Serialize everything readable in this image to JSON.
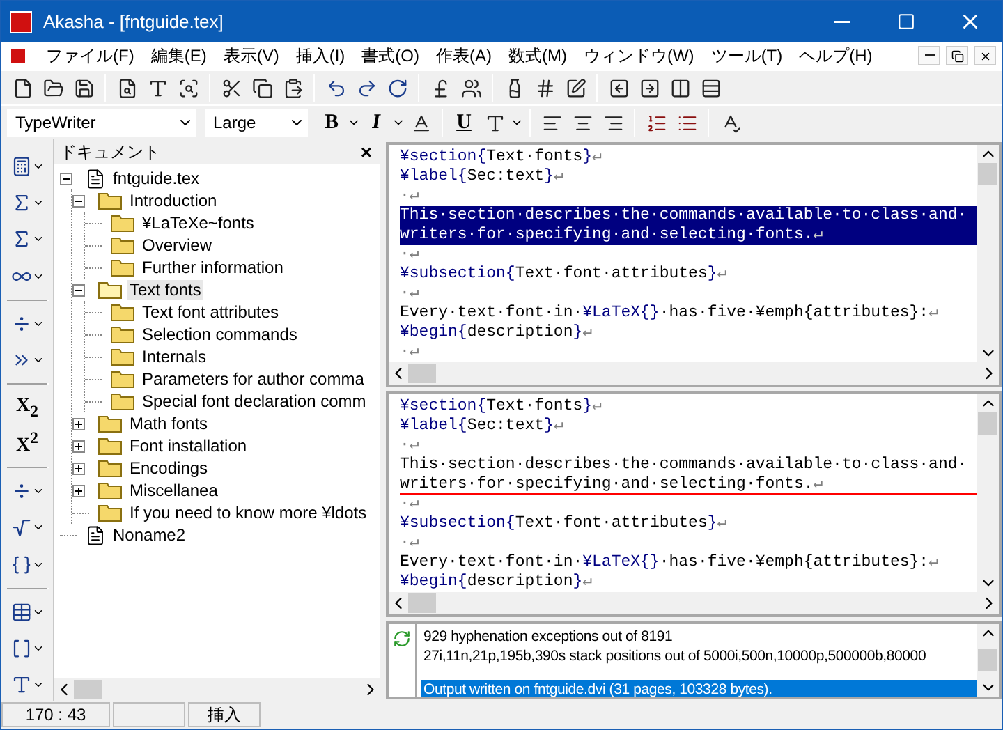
{
  "window": {
    "title": "Akasha - [fntguide.tex]"
  },
  "menu": [
    "ファイル(F)",
    "編集(E)",
    "表示(V)",
    "挿入(I)",
    "書式(O)",
    "作表(A)",
    "数式(M)",
    "ウィンドウ(W)",
    "ツール(T)",
    "ヘルプ(H)"
  ],
  "format_bar": {
    "font": "TypeWriter",
    "size": "Large",
    "bold": "B",
    "italic": "I",
    "underline": "U"
  },
  "side_toolbar": {
    "subscript": "X$_{2}$",
    "superscript": "X$^{2}$"
  },
  "document_panel": {
    "title": "ドキュメント",
    "close": "×",
    "tree": [
      {
        "label": "fntguide.tex",
        "kind": "file",
        "expanded": true,
        "selected": false,
        "children": [
          {
            "label": "Introduction",
            "kind": "folder",
            "expanded": true,
            "selected": false,
            "children": [
              {
                "label": "¥LaTeXe~fonts",
                "kind": "folder",
                "selected": false
              },
              {
                "label": "Overview",
                "kind": "folder",
                "selected": false
              },
              {
                "label": "Further information",
                "kind": "folder",
                "selected": false
              }
            ]
          },
          {
            "label": "Text fonts",
            "kind": "folder",
            "expanded": true,
            "selected": true,
            "children": [
              {
                "label": "Text font attributes",
                "kind": "folder",
                "selected": false
              },
              {
                "label": "Selection commands",
                "kind": "folder",
                "selected": false
              },
              {
                "label": "Internals",
                "kind": "folder",
                "selected": false
              },
              {
                "label": "Parameters for author comma",
                "kind": "folder",
                "selected": false
              },
              {
                "label": "Special font declaration comm",
                "kind": "folder",
                "selected": false
              }
            ]
          },
          {
            "label": "Math fonts",
            "kind": "folder",
            "expanded": false,
            "selected": false
          },
          {
            "label": "Font installation",
            "kind": "folder",
            "expanded": false,
            "selected": false
          },
          {
            "label": "Encodings",
            "kind": "folder",
            "expanded": false,
            "selected": false
          },
          {
            "label": "Miscellanea",
            "kind": "folder",
            "expanded": false,
            "selected": false
          },
          {
            "label": "If you need to know more ¥ldots",
            "kind": "folder",
            "selected": false
          }
        ]
      },
      {
        "label": "Noname2",
        "kind": "file",
        "selected": false
      }
    ]
  },
  "editor_panes": [
    {
      "lines": [
        {
          "selected": false,
          "current": false,
          "segments": [
            {
              "kind": "command",
              "text": "¥section{"
            },
            {
              "kind": "plain",
              "text": "Text·fonts"
            },
            {
              "kind": "command",
              "text": "}"
            },
            {
              "kind": "mark",
              "text": "↵"
            }
          ]
        },
        {
          "selected": false,
          "current": false,
          "segments": [
            {
              "kind": "command",
              "text": "¥label{"
            },
            {
              "kind": "plain",
              "text": "Sec:text"
            },
            {
              "kind": "command",
              "text": "}"
            },
            {
              "kind": "mark",
              "text": "↵"
            }
          ]
        },
        {
          "selected": false,
          "current": false,
          "segments": [
            {
              "kind": "mark",
              "text": "·↵"
            }
          ]
        },
        {
          "selected": true,
          "current": false,
          "segments": [
            {
              "kind": "plain",
              "text": "This·section·describes·the·commands·available·to·class·and·"
            }
          ]
        },
        {
          "selected": true,
          "current": false,
          "segments": [
            {
              "kind": "plain",
              "text": "writers·for·specifying·and·selecting·fonts."
            },
            {
              "kind": "mark",
              "text": "↵"
            }
          ]
        },
        {
          "selected": false,
          "current": false,
          "segments": [
            {
              "kind": "mark",
              "text": "·↵"
            }
          ]
        },
        {
          "selected": false,
          "current": false,
          "segments": [
            {
              "kind": "command",
              "text": "¥subsection{"
            },
            {
              "kind": "plain",
              "text": "Text·font·attributes"
            },
            {
              "kind": "command",
              "text": "}"
            },
            {
              "kind": "mark",
              "text": "↵"
            }
          ]
        },
        {
          "selected": false,
          "current": false,
          "segments": [
            {
              "kind": "mark",
              "text": "·↵"
            }
          ]
        },
        {
          "selected": false,
          "current": false,
          "segments": [
            {
              "kind": "plain",
              "text": "Every·text·font·in·"
            },
            {
              "kind": "command",
              "text": "¥LaTeX{}"
            },
            {
              "kind": "plain",
              "text": "·has·five·¥emph{attributes}:"
            },
            {
              "kind": "mark",
              "text": "↵"
            }
          ]
        },
        {
          "selected": false,
          "current": false,
          "segments": [
            {
              "kind": "command",
              "text": "¥begin{"
            },
            {
              "kind": "plain",
              "text": "description"
            },
            {
              "kind": "command",
              "text": "}"
            },
            {
              "kind": "mark",
              "text": "↵"
            }
          ]
        },
        {
          "selected": false,
          "current": false,
          "segments": [
            {
              "kind": "mark",
              "text": "·↵"
            }
          ]
        }
      ]
    },
    {
      "lines": [
        {
          "selected": false,
          "current": false,
          "segments": [
            {
              "kind": "command",
              "text": "¥section{"
            },
            {
              "kind": "plain",
              "text": "Text·fonts"
            },
            {
              "kind": "command",
              "text": "}"
            },
            {
              "kind": "mark",
              "text": "↵"
            }
          ]
        },
        {
          "selected": false,
          "current": false,
          "segments": [
            {
              "kind": "command",
              "text": "¥label{"
            },
            {
              "kind": "plain",
              "text": "Sec:text"
            },
            {
              "kind": "command",
              "text": "}"
            },
            {
              "kind": "mark",
              "text": "↵"
            }
          ]
        },
        {
          "selected": false,
          "current": false,
          "segments": [
            {
              "kind": "mark",
              "text": "·↵"
            }
          ]
        },
        {
          "selected": false,
          "current": false,
          "segments": [
            {
              "kind": "plain",
              "text": "This·section·describes·the·commands·available·to·class·and·"
            }
          ]
        },
        {
          "selected": false,
          "current": true,
          "segments": [
            {
              "kind": "plain",
              "text": "writers·for·specifying·and·selecting·fonts."
            },
            {
              "kind": "mark",
              "text": "↵"
            }
          ]
        },
        {
          "selected": false,
          "current": false,
          "segments": [
            {
              "kind": "mark",
              "text": "·↵"
            }
          ]
        },
        {
          "selected": false,
          "current": false,
          "segments": [
            {
              "kind": "command",
              "text": "¥subsection{"
            },
            {
              "kind": "plain",
              "text": "Text·font·attributes"
            },
            {
              "kind": "command",
              "text": "}"
            },
            {
              "kind": "mark",
              "text": "↵"
            }
          ]
        },
        {
          "selected": false,
          "current": false,
          "segments": [
            {
              "kind": "mark",
              "text": "·↵"
            }
          ]
        },
        {
          "selected": false,
          "current": false,
          "segments": [
            {
              "kind": "plain",
              "text": "Every·text·font·in·"
            },
            {
              "kind": "command",
              "text": "¥LaTeX{}"
            },
            {
              "kind": "plain",
              "text": "·has·five·¥emph{attributes}:"
            },
            {
              "kind": "mark",
              "text": "↵"
            }
          ]
        },
        {
          "selected": false,
          "current": false,
          "segments": [
            {
              "kind": "command",
              "text": "¥begin{"
            },
            {
              "kind": "plain",
              "text": "description"
            },
            {
              "kind": "command",
              "text": "}"
            },
            {
              "kind": "mark",
              "text": "↵"
            }
          ]
        }
      ]
    }
  ],
  "log": [
    {
      "text": "929 hyphenation exceptions out of 8191",
      "selected": false
    },
    {
      "text": "27i,11n,21p,195b,390s stack positions out of 5000i,500n,10000p,500000b,80000",
      "selected": false
    },
    {
      "text": "Output written on fntguide.dvi (31 pages, 103328 bytes).",
      "selected": true
    }
  ],
  "status_bar": [
    "170 : 43",
    "挿入"
  ]
}
